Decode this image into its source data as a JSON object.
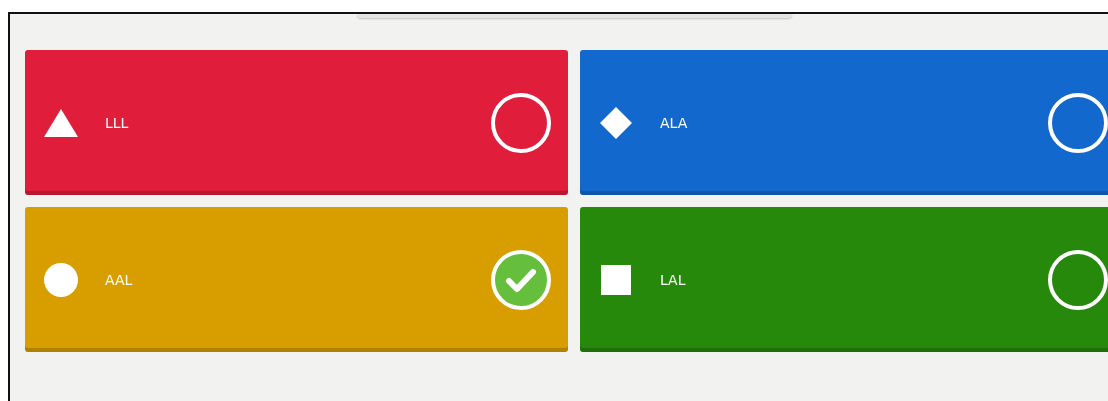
{
  "answers": [
    {
      "kind": "triangle",
      "label": "LLL",
      "color": "#e11d3c",
      "selected": false
    },
    {
      "kind": "diamond",
      "label": "ALA",
      "color": "#1368ce",
      "selected": false
    },
    {
      "kind": "circle",
      "label": "AAL",
      "color": "#d89e00",
      "selected": true
    },
    {
      "kind": "square",
      "label": "LAL",
      "color": "#26890c",
      "selected": false
    }
  ]
}
